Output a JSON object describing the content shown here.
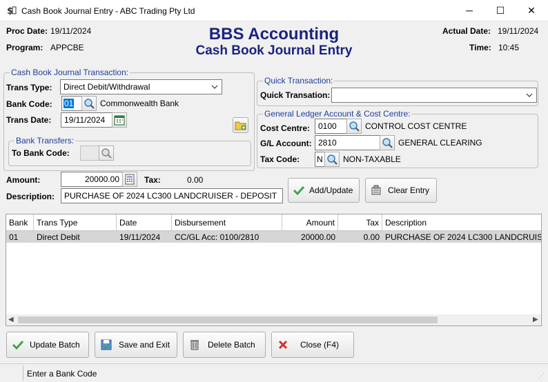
{
  "window": {
    "title": "Cash Book Journal Entry - ABC Trading Pty Ltd",
    "controls": {
      "minimize": "─",
      "maximize": "☐",
      "close": "✕"
    }
  },
  "header": {
    "proc_date_label": "Proc Date:",
    "proc_date": "19/11/2024",
    "program_label": "Program:",
    "program": "APPCBE",
    "app_title": "BBS Accounting",
    "app_subtitle": "Cash Book Journal Entry",
    "actual_date_label": "Actual Date:",
    "actual_date": "19/11/2024",
    "time_label": "Time:",
    "time": "10:45"
  },
  "transaction": {
    "legend": "Cash Book Journal Transaction:",
    "trans_type_label": "Trans Type:",
    "trans_type": "Direct Debit/Withdrawal",
    "bank_code_label": "Bank Code:",
    "bank_code": "01",
    "bank_name": "Commonwealth Bank",
    "trans_date_label": "Trans Date:",
    "trans_date": "19/11/2024"
  },
  "bank_transfers": {
    "legend": "Bank Transfers:",
    "to_bank_code_label": "To Bank Code:",
    "to_bank_code": ""
  },
  "quick": {
    "legend": "Quick Transaction:",
    "label": "Quick Transation:",
    "value": ""
  },
  "gl": {
    "legend": "General Ledger Account & Cost Centre:",
    "cost_centre_label": "Cost Centre:",
    "cost_centre": "0100",
    "cost_centre_name": "CONTROL COST CENTRE",
    "gl_account_label": "G/L Account:",
    "gl_account": "2810",
    "gl_account_name": "GENERAL CLEARING",
    "tax_code_label": "Tax Code:",
    "tax_code": "N",
    "tax_code_name": "NON-TAXABLE"
  },
  "entry": {
    "amount_label": "Amount:",
    "amount": "20000.00",
    "tax_label": "Tax:",
    "tax": "0.00",
    "description_label": "Description:",
    "description": "PURCHASE OF 2024 LC300 LANDCRUISER - DEPOSIT",
    "add_update": "Add/Update",
    "clear_entry": "Clear Entry"
  },
  "grid": {
    "columns": [
      "Bank",
      "Trans Type",
      "Date",
      "Disbursement",
      "Amount",
      "Tax",
      "Description"
    ],
    "rows": [
      [
        "01",
        "Direct Debit",
        "19/11/2024",
        "CC/GL Acc: 0100/2810",
        "20000.00",
        "0.00",
        "PURCHASE OF 2024 LC300 LANDCRUIS"
      ]
    ]
  },
  "buttons": {
    "update_batch": "Update Batch",
    "save_exit": "Save and Exit",
    "delete_batch": "Delete Batch",
    "close": "Close (F4)"
  },
  "status": {
    "message": "Enter a Bank Code"
  },
  "colors": {
    "title_blue": "#1a237e",
    "legend_blue": "#1f3d99",
    "selection": "#d6d6d6"
  }
}
